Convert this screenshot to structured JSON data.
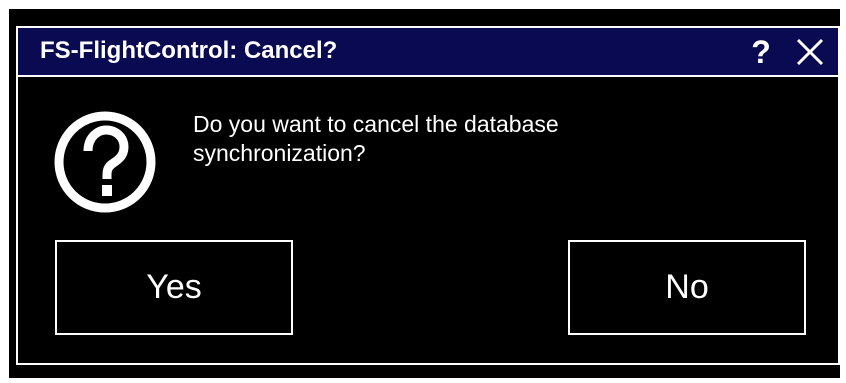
{
  "dialog": {
    "title": "FS-FlightControl: Cancel?",
    "help_label": "?",
    "message": "Do you want to cancel the database synchronization?",
    "icon": "question-icon",
    "buttons": {
      "yes_label": "Yes",
      "no_label": "No"
    }
  },
  "colors": {
    "background": "#000000",
    "titlebar": "#0a0a52",
    "foreground": "#ffffff"
  }
}
